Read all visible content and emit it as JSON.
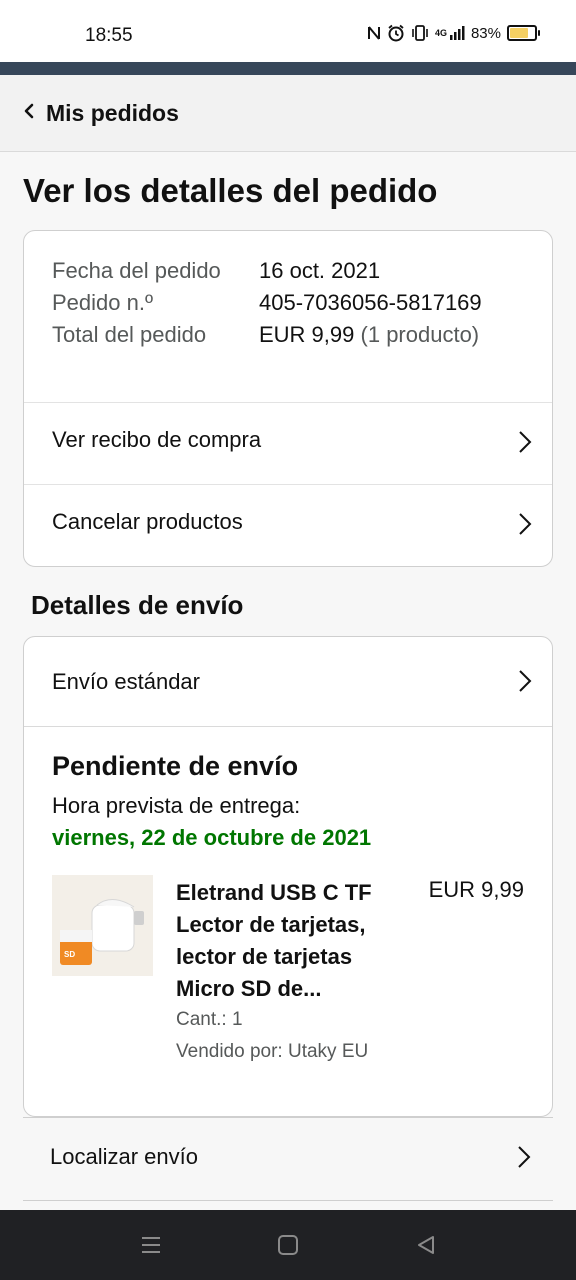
{
  "status_bar": {
    "time": "18:55",
    "network": "4G",
    "battery": "83%",
    "battery_level": 0.83,
    "battery_color": "#f5d063",
    "icons": [
      "nfc-icon",
      "alarm-icon",
      "vibrate-icon",
      "signal-icon",
      "battery-icon"
    ]
  },
  "header": {
    "back_label": "Mis pedidos"
  },
  "page": {
    "title": "Ver los detalles del pedido"
  },
  "order": {
    "date_label": "Fecha del pedido",
    "date_value": "16 oct. 2021",
    "number_label": "Pedido n.º",
    "number_value": "405-7036056-5817169",
    "total_label": "Total del pedido",
    "total_value": "EUR 9,99",
    "total_count": "(1 producto)",
    "receipt_link": "Ver recibo de compra",
    "cancel_link": "Cancelar productos"
  },
  "shipping": {
    "section_title": "Detalles de envío",
    "method": "Envío estándar",
    "status": "Pendiente de envío",
    "eta_label": "Hora prevista de entrega:",
    "eta_date": "viernes, 22 de octubre de 2021",
    "eta_color": "#007600",
    "track_link": "Localizar envío"
  },
  "product": {
    "title": "Eletrand USB C TF Lector de tarjetas, lector de tarjetas Micro SD de...",
    "price": "EUR 9,99",
    "quantity": "Cant.: 1",
    "seller": "Vendido por: Utaky EU"
  },
  "colors": {
    "topbar": "#37475a",
    "muted_text": "#565959"
  }
}
